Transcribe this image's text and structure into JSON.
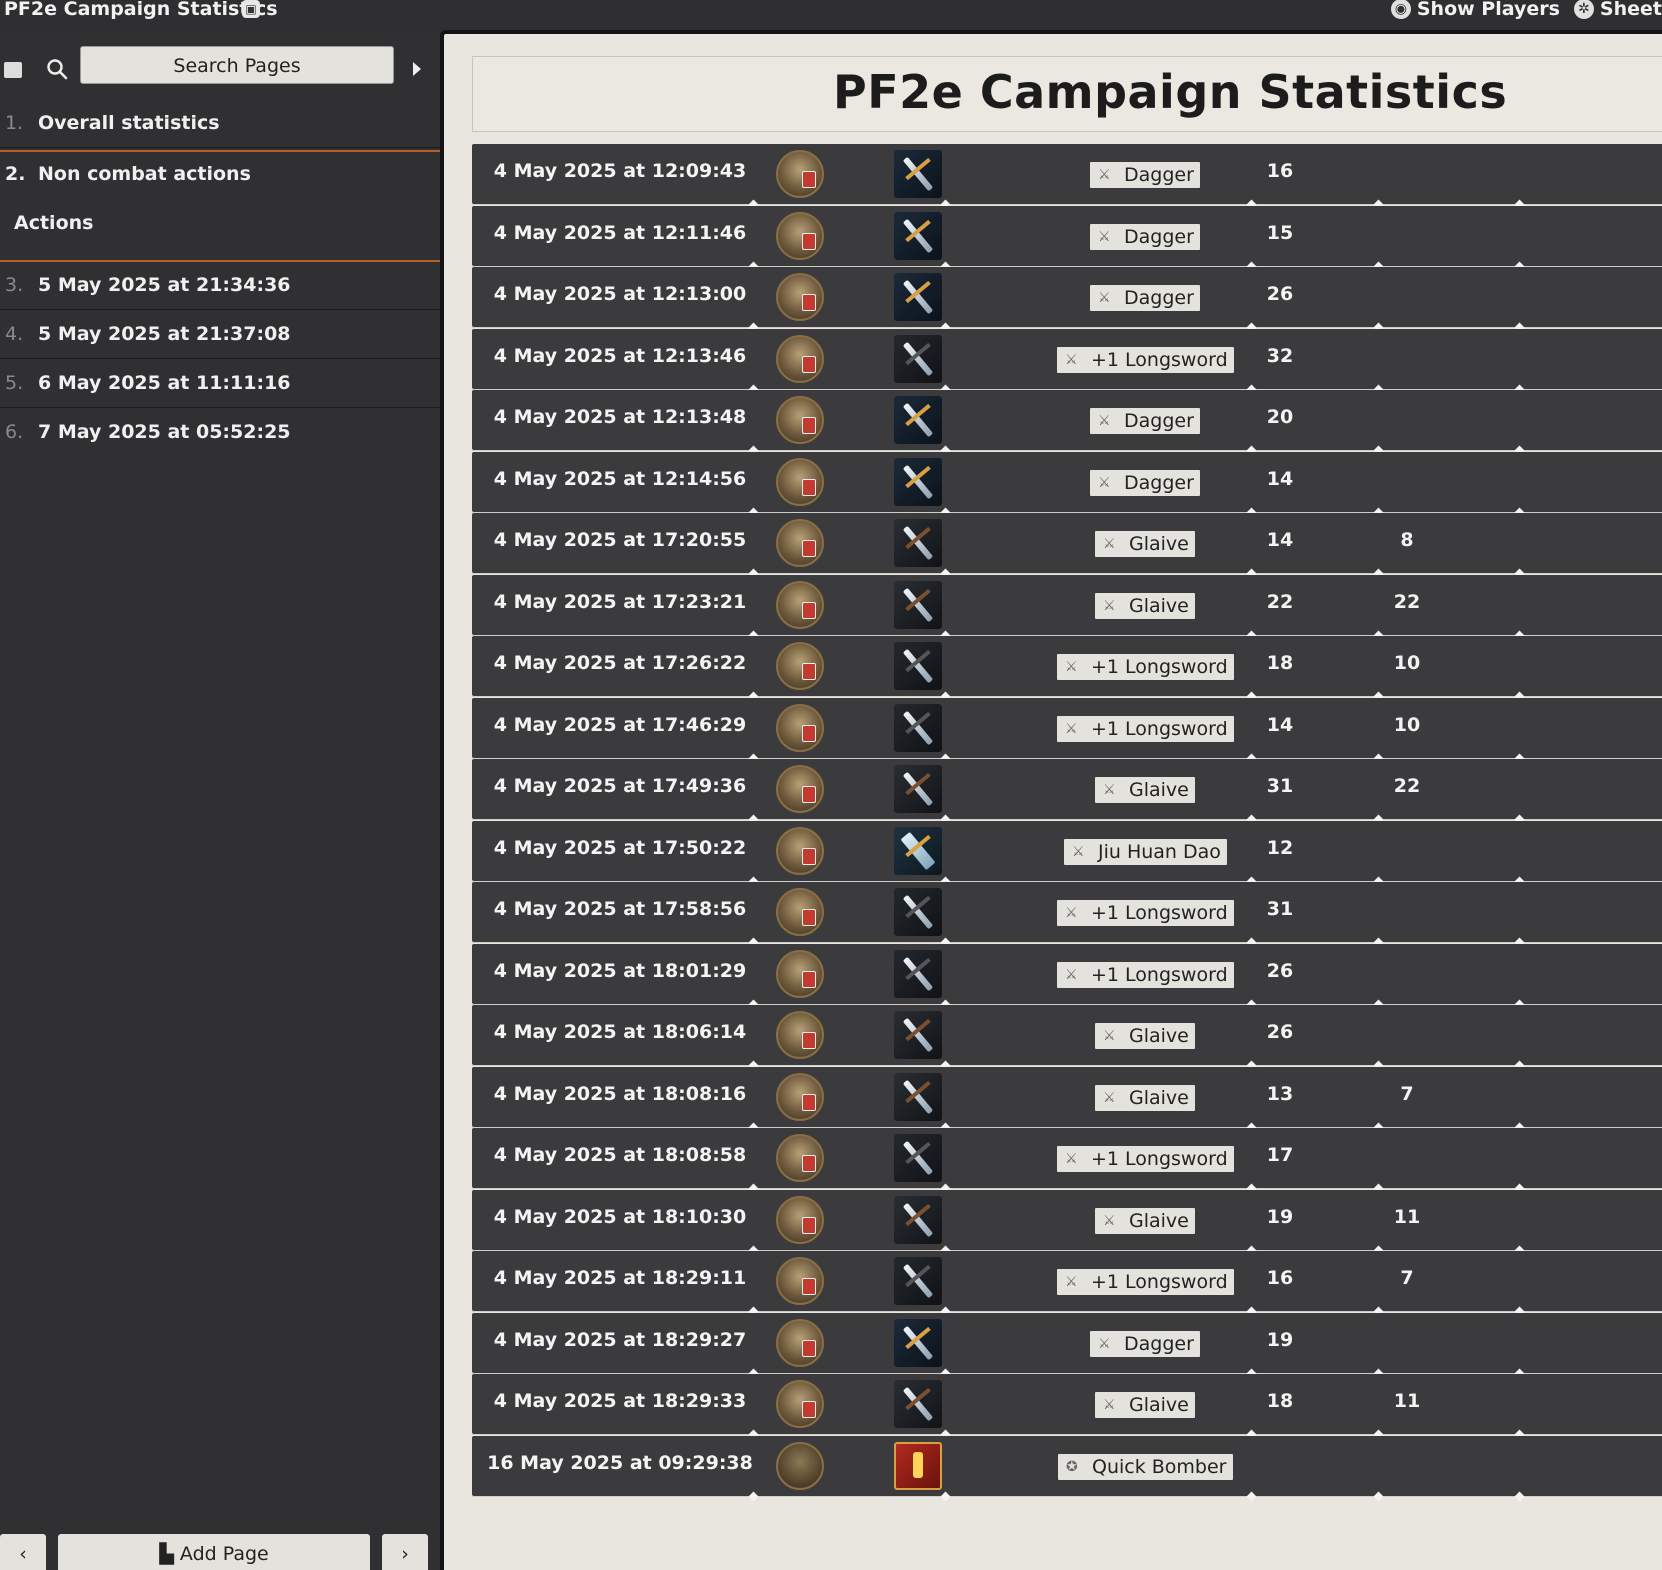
{
  "app": {
    "title": "PF2e Campaign Statistics",
    "title_icon": "journal-badge-icon",
    "buttons": [
      {
        "label": "Show Players",
        "icon": "eye-icon"
      },
      {
        "label": "Sheet",
        "icon": "gear-icon"
      }
    ]
  },
  "sidebar": {
    "search_placeholder": "Search Pages",
    "nav": [
      {
        "num": "1.",
        "label": "Overall statistics",
        "active": false
      },
      {
        "num": "2.",
        "label": "Non combat actions",
        "active": true
      },
      {
        "num": "3.",
        "label": "5 May 2025 at 21:34:36",
        "active": false
      },
      {
        "num": "4.",
        "label": "5 May 2025 at 21:37:08",
        "active": false
      },
      {
        "num": "5.",
        "label": "6 May 2025 at 11:11:16",
        "active": false
      },
      {
        "num": "6.",
        "label": "7 May 2025 at 05:52:25",
        "active": false
      }
    ],
    "sub_heading": "Actions",
    "add_page": "Add Page"
  },
  "main": {
    "page_title": "PF2e Campaign Statistics",
    "rows": [
      {
        "date": "4 May 2025 at 12:09:43",
        "weapon": "dagger",
        "item": "Dagger",
        "v1": "16",
        "v2": ""
      },
      {
        "date": "4 May 2025 at 12:11:46",
        "weapon": "dagger",
        "item": "Dagger",
        "v1": "15",
        "v2": ""
      },
      {
        "date": "4 May 2025 at 12:13:00",
        "weapon": "dagger",
        "item": "Dagger",
        "v1": "26",
        "v2": ""
      },
      {
        "date": "4 May 2025 at 12:13:46",
        "weapon": "longsword",
        "item": "+1 Longsword",
        "v1": "32",
        "v2": ""
      },
      {
        "date": "4 May 2025 at 12:13:48",
        "weapon": "dagger",
        "item": "Dagger",
        "v1": "20",
        "v2": ""
      },
      {
        "date": "4 May 2025 at 12:14:56",
        "weapon": "dagger",
        "item": "Dagger",
        "v1": "14",
        "v2": ""
      },
      {
        "date": "4 May 2025 at 17:20:55",
        "weapon": "glaive",
        "item": "Glaive",
        "v1": "14",
        "v2": "8"
      },
      {
        "date": "4 May 2025 at 17:23:21",
        "weapon": "glaive",
        "item": "Glaive",
        "v1": "22",
        "v2": "22"
      },
      {
        "date": "4 May 2025 at 17:26:22",
        "weapon": "longsword",
        "item": "+1 Longsword",
        "v1": "18",
        "v2": "10"
      },
      {
        "date": "4 May 2025 at 17:46:29",
        "weapon": "longsword",
        "item": "+1 Longsword",
        "v1": "14",
        "v2": "10"
      },
      {
        "date": "4 May 2025 at 17:49:36",
        "weapon": "glaive",
        "item": "Glaive",
        "v1": "31",
        "v2": "22"
      },
      {
        "date": "4 May 2025 at 17:50:22",
        "weapon": "jiu",
        "item": "Jiu Huan Dao",
        "v1": "12",
        "v2": ""
      },
      {
        "date": "4 May 2025 at 17:58:56",
        "weapon": "longsword",
        "item": "+1 Longsword",
        "v1": "31",
        "v2": ""
      },
      {
        "date": "4 May 2025 at 18:01:29",
        "weapon": "longsword",
        "item": "+1 Longsword",
        "v1": "26",
        "v2": ""
      },
      {
        "date": "4 May 2025 at 18:06:14",
        "weapon": "glaive",
        "item": "Glaive",
        "v1": "26",
        "v2": ""
      },
      {
        "date": "4 May 2025 at 18:08:16",
        "weapon": "glaive",
        "item": "Glaive",
        "v1": "13",
        "v2": "7"
      },
      {
        "date": "4 May 2025 at 18:08:58",
        "weapon": "longsword",
        "item": "+1 Longsword",
        "v1": "17",
        "v2": ""
      },
      {
        "date": "4 May 2025 at 18:10:30",
        "weapon": "glaive",
        "item": "Glaive",
        "v1": "19",
        "v2": "11"
      },
      {
        "date": "4 May 2025 at 18:29:11",
        "weapon": "longsword",
        "item": "+1 Longsword",
        "v1": "16",
        "v2": "7"
      },
      {
        "date": "4 May 2025 at 18:29:27",
        "weapon": "dagger",
        "item": "Dagger",
        "v1": "19",
        "v2": ""
      },
      {
        "date": "4 May 2025 at 18:29:33",
        "weapon": "glaive",
        "item": "Glaive",
        "v1": "18",
        "v2": "11"
      },
      {
        "date": "16 May 2025 at 09:29:38",
        "weapon": "bomb",
        "item": "Quick Bomber",
        "v1": "",
        "v2": "",
        "actor_alt": true,
        "tag_icon": "medal-icon"
      }
    ]
  }
}
